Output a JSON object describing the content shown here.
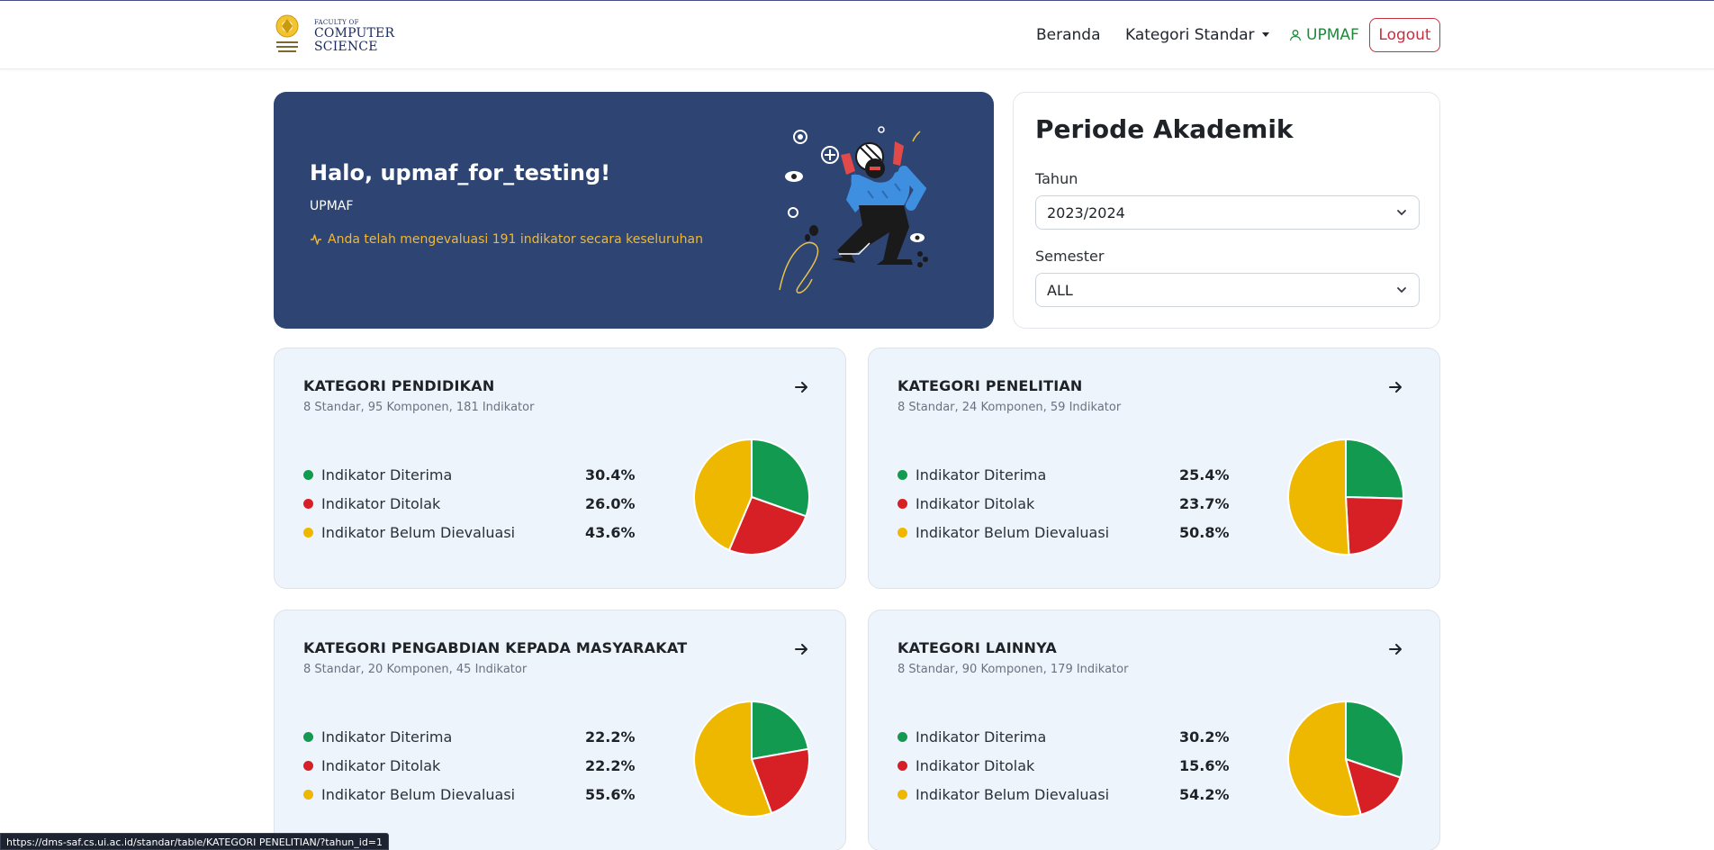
{
  "brand": {
    "logo_small": "FACULTY OF",
    "logo_line1": "COMPUTER",
    "logo_line2": "SCIENCE",
    "accent": "#2e4473"
  },
  "nav": {
    "beranda": "Beranda",
    "kategori": "Kategori Standar",
    "user": "UPMAF",
    "logout": "Logout"
  },
  "hero": {
    "greeting": "Halo, upmaf_for_testing!",
    "role": "UPMAF",
    "note": "Anda telah mengevaluasi 191 indikator secara keseluruhan"
  },
  "period": {
    "title": "Periode Akademik",
    "year_label": "Tahun",
    "year_value": "2023/2024",
    "semester_label": "Semester",
    "semester_value": "ALL"
  },
  "legend_labels": {
    "accepted": "Indikator Diterima",
    "rejected": "Indikator Ditolak",
    "pending": "Indikator Belum Dievaluasi"
  },
  "colors": {
    "accepted": "#139a51",
    "rejected": "#d71f26",
    "pending": "#efb800"
  },
  "categories": [
    {
      "title": "KATEGORI PENDIDIKAN",
      "sub": "8 Standar, 95 Komponen, 181 Indikator",
      "accepted": "30.4%",
      "rejected": "26.0%",
      "pending": "43.6%"
    },
    {
      "title": "KATEGORI PENELITIAN",
      "sub": "8 Standar, 24 Komponen, 59 Indikator",
      "accepted": "25.4%",
      "rejected": "23.7%",
      "pending": "50.8%"
    },
    {
      "title": "KATEGORI PENGABDIAN KEPADA MASYARAKAT",
      "sub": "8 Standar, 20 Komponen, 45 Indikator",
      "accepted": "22.2%",
      "rejected": "22.2%",
      "pending": "55.6%"
    },
    {
      "title": "KATEGORI LAINNYA",
      "sub": "8 Standar, 90 Komponen, 179 Indikator",
      "accepted": "30.2%",
      "rejected": "15.6%",
      "pending": "54.2%"
    }
  ],
  "chart_data": [
    {
      "type": "pie",
      "categories": [
        "Indikator Diterima",
        "Indikator Ditolak",
        "Indikator Belum Dievaluasi"
      ],
      "values": [
        30.4,
        26.0,
        43.6
      ]
    },
    {
      "type": "pie",
      "categories": [
        "Indikator Diterima",
        "Indikator Ditolak",
        "Indikator Belum Dievaluasi"
      ],
      "values": [
        25.4,
        23.7,
        50.8
      ]
    },
    {
      "type": "pie",
      "categories": [
        "Indikator Diterima",
        "Indikator Ditolak",
        "Indikator Belum Dievaluasi"
      ],
      "values": [
        22.2,
        22.2,
        55.6
      ]
    },
    {
      "type": "pie",
      "categories": [
        "Indikator Diterima",
        "Indikator Ditolak",
        "Indikator Belum Dievaluasi"
      ],
      "values": [
        30.2,
        15.6,
        54.2
      ]
    }
  ],
  "status_url": "https://dms-saf.cs.ui.ac.id/standar/table/KATEGORI PENELITIAN/?tahun_id=1"
}
